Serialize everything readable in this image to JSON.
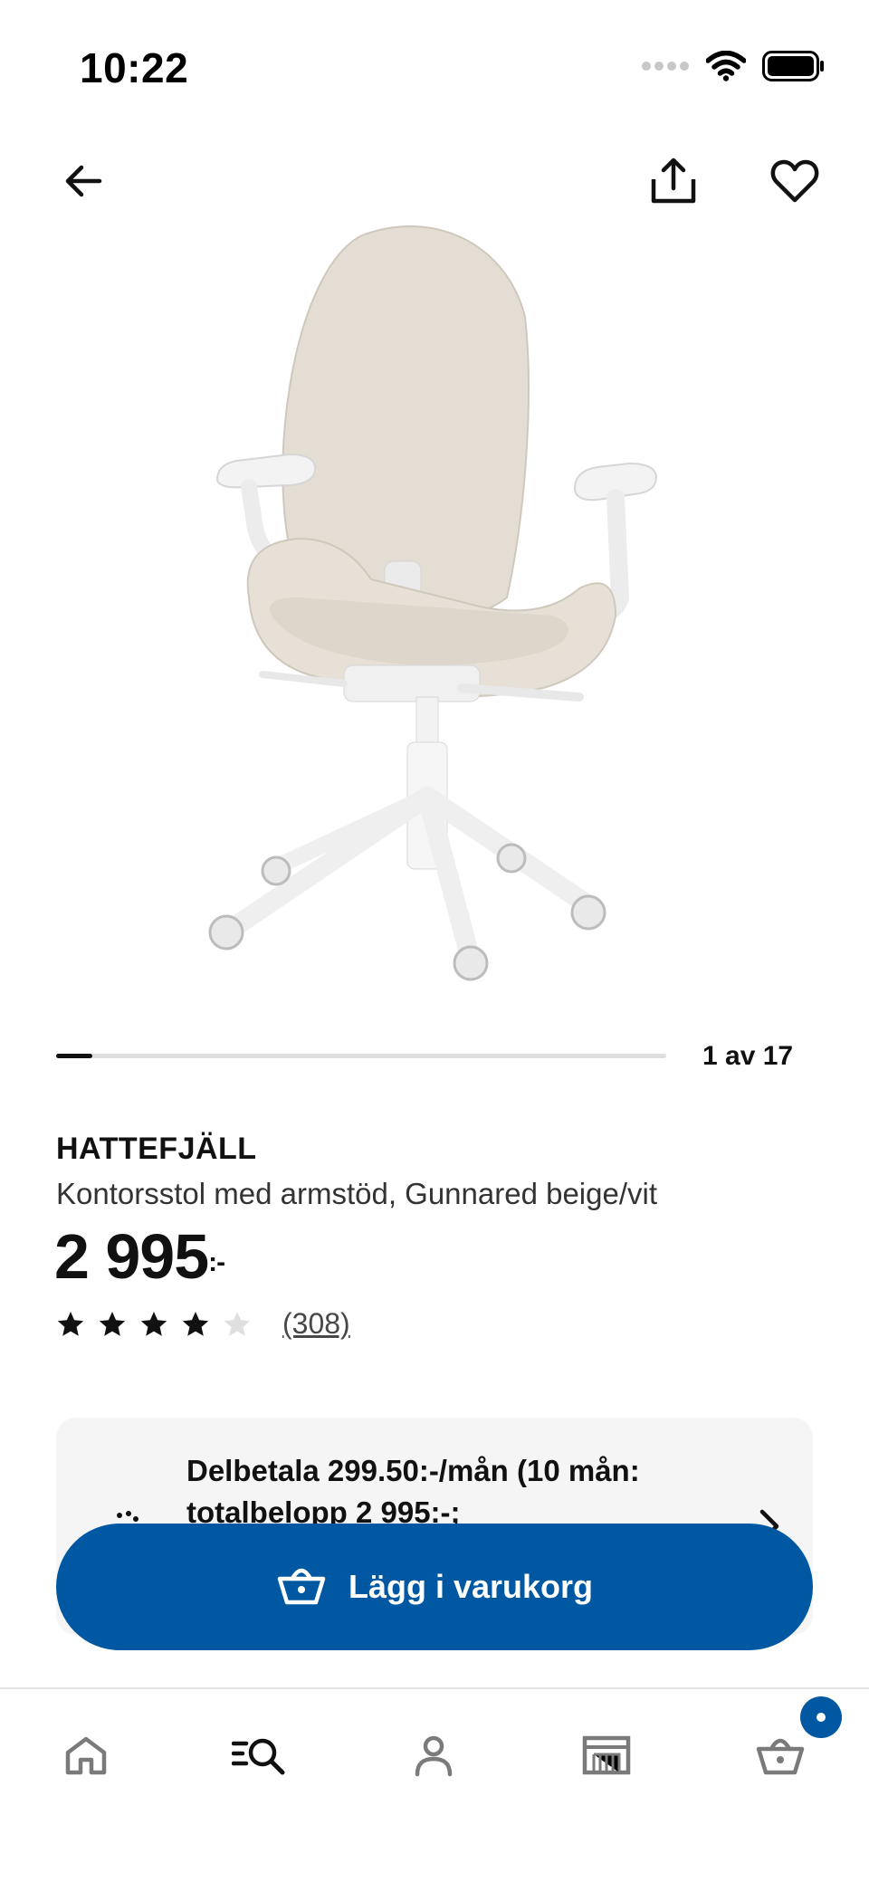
{
  "status_bar": {
    "time": "10:22",
    "icons": [
      "signal-icon",
      "wifi-icon",
      "battery-icon"
    ]
  },
  "top_nav": {
    "icons": [
      "arrow-left-icon",
      "share-icon",
      "heart-icon"
    ]
  },
  "carousel": {
    "counter": "1 av 17",
    "progress_fraction": 0.0588
  },
  "product": {
    "name": "HATTEFJÄLL",
    "description": "Kontorsstol med armstöd, Gunnared beige/vit",
    "price_main": "2 995",
    "price_suffix": ":-",
    "rating_value": 4,
    "rating_max": 5,
    "review_count": "(308)"
  },
  "installment": {
    "text": "Delbetala 299.50:-/mån (10 mån: totalbelopp 2 995:-;"
  },
  "cta": {
    "label": "Lägg i varukorg"
  },
  "tab_bar": {
    "tabs": [
      "home-icon",
      "search-icon",
      "profile-icon",
      "store-icon",
      "cart-icon"
    ]
  },
  "colors": {
    "brand_blue": "#0058a3",
    "text_primary": "#111111",
    "card_background": "#f5f5f5"
  }
}
